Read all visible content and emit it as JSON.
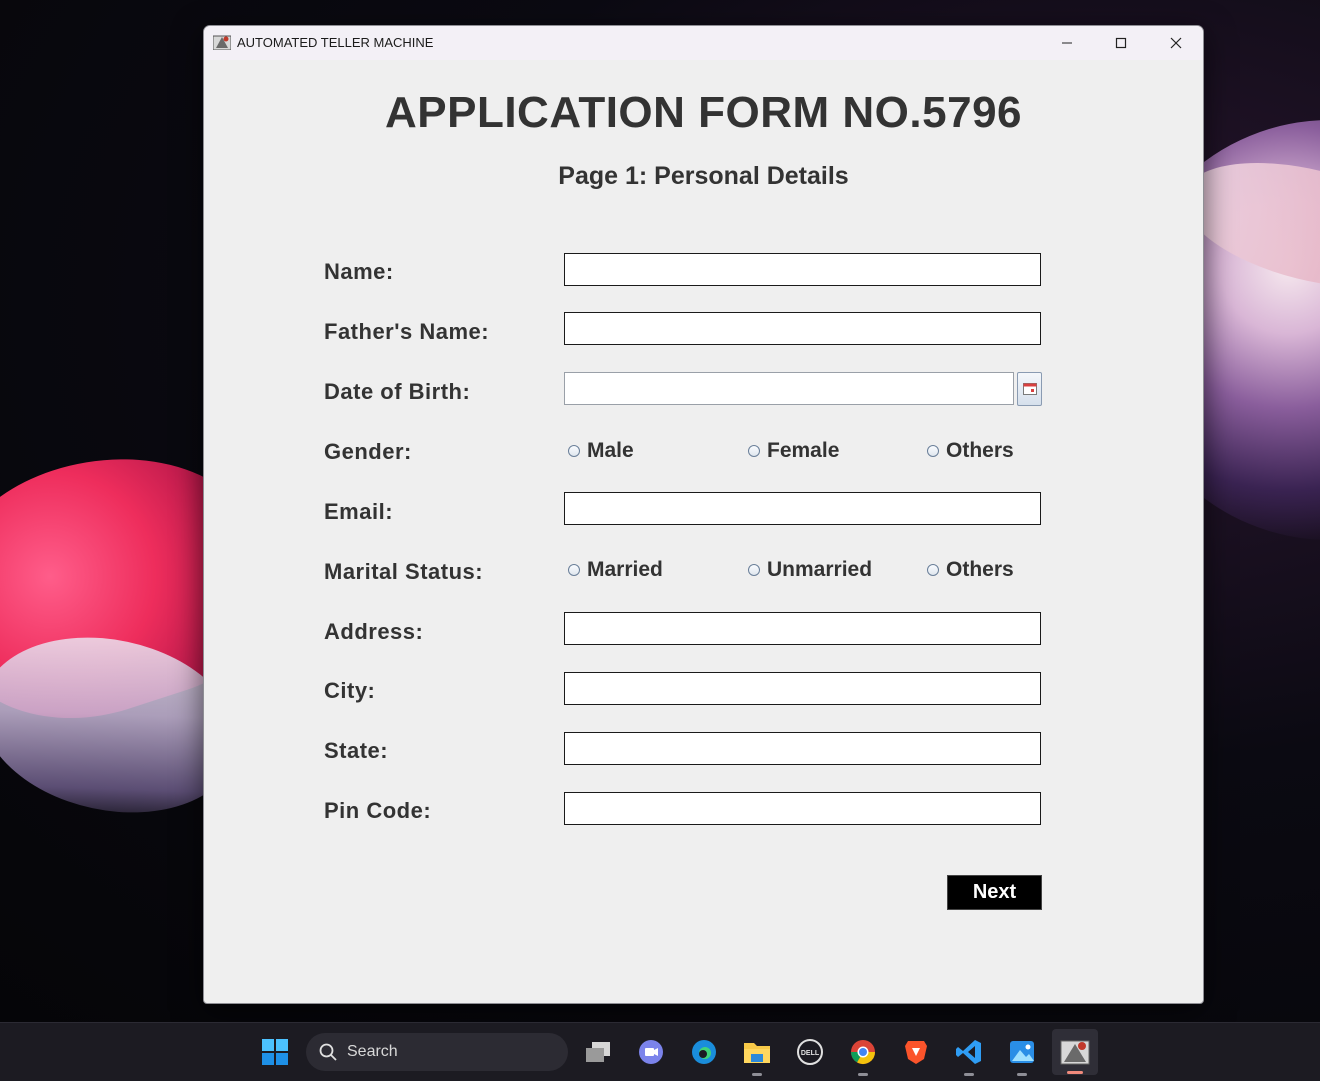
{
  "window": {
    "title": "AUTOMATED TELLER MACHINE"
  },
  "form": {
    "heading": "APPLICATION FORM NO.5796",
    "subheading": "Page 1: Personal Details",
    "labels": {
      "name": "Name:",
      "father_name": "Father's Name:",
      "dob": "Date of Birth:",
      "gender": "Gender:",
      "email": "Email:",
      "marital": "Marital Status:",
      "address": "Address:",
      "city": "City:",
      "state": "State:",
      "pin": "Pin Code:"
    },
    "values": {
      "name": "",
      "father_name": "",
      "dob": "",
      "email": "",
      "address": "",
      "city": "",
      "state": "",
      "pin": ""
    },
    "gender_options": [
      "Male",
      "Female",
      "Others"
    ],
    "marital_options": [
      "Married",
      "Unmarried",
      "Others"
    ],
    "next_label": "Next"
  },
  "taskbar": {
    "search_placeholder": "Search",
    "icons": [
      "start-icon",
      "search-icon",
      "task-view-icon",
      "teams-chat-icon",
      "edge-icon",
      "file-explorer-icon",
      "dell-icon",
      "chrome-icon",
      "brave-icon",
      "vscode-icon",
      "photos-icon",
      "java-app-icon"
    ]
  }
}
